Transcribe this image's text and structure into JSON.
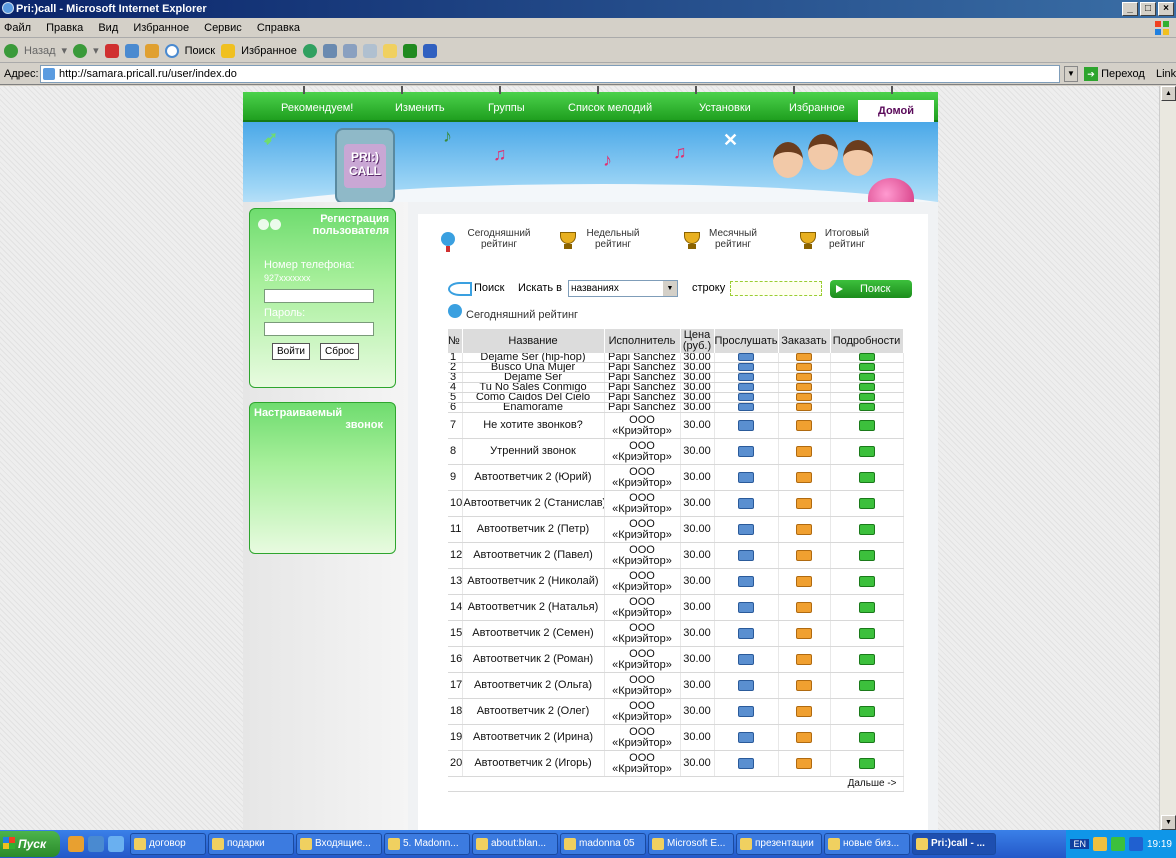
{
  "window": {
    "title": "Pri:)call - Microsoft Internet Explorer",
    "controls": [
      "_",
      "□",
      "×"
    ]
  },
  "menu": [
    "Файл",
    "Правка",
    "Вид",
    "Избранное",
    "Сервис",
    "Справка"
  ],
  "toolbar": {
    "back": "Назад",
    "search": "Поиск",
    "favorites": "Избранное"
  },
  "address": {
    "label": "Адрес:",
    "url": "http://samara.pricall.ru/user/index.do",
    "go": "Переход",
    "links": "Links"
  },
  "site": {
    "nav": [
      "Рекомендуем!",
      "Изменить",
      "Группы",
      "Список мелодий",
      "Установки",
      "Избранное"
    ],
    "nav_active": "Домой",
    "logo_line1": "PRI:)",
    "logo_line2": "CALL",
    "registration": {
      "title_line1": "Регистрация",
      "title_line2": "пользователя",
      "phone_label": "Номер телефона:",
      "phone_hint": "927xxxxxxx",
      "password_label": "Пароль:",
      "login_button": "Войти",
      "reset_button": "Сброс"
    },
    "custom_ring": {
      "title_line1": "Настраиваемый",
      "title_line2": "звонок"
    },
    "ratings": [
      {
        "line1": "Сегодняшний",
        "line2": "рейтинг",
        "icon": "pin-icon"
      },
      {
        "line1": "Недельный",
        "line2": "рейтинг",
        "icon": "trophy-icon"
      },
      {
        "line1": "Месячный",
        "line2": "рейтинг",
        "icon": "trophy-icon"
      },
      {
        "line1": "Итоговый",
        "line2": "рейтинг",
        "icon": "trophy-icon"
      }
    ],
    "search": {
      "label": "Поиск",
      "search_in": "Искать в",
      "select_value": "названиях",
      "string_label": "строку",
      "button": "Поиск"
    },
    "today_title": "Сегодняшний рейтинг",
    "table": {
      "headers": [
        "№",
        "Название",
        "Исполнитель",
        "Цена (руб.)",
        "Прослушать",
        "Заказать",
        "Подробности"
      ],
      "rows": [
        {
          "n": "1",
          "title": "Dejame Ser (hip-hop)",
          "artist": "Papi Sanchez",
          "artist2": "",
          "price": "30.00"
        },
        {
          "n": "2",
          "title": "Busco Una Mujer",
          "artist": "Papi Sanchez",
          "artist2": "",
          "price": "30.00"
        },
        {
          "n": "3",
          "title": "Dejame Ser",
          "artist": "Papi Sanchez",
          "artist2": "",
          "price": "30.00"
        },
        {
          "n": "4",
          "title": "Tu No Sales Conmigo",
          "artist": "Papi Sanchez",
          "artist2": "",
          "price": "30.00"
        },
        {
          "n": "5",
          "title": "Como Caidos Del Cielo",
          "artist": "Papi Sanchez",
          "artist2": "",
          "price": "30.00"
        },
        {
          "n": "6",
          "title": "Enamorame",
          "artist": "Papi Sanchez",
          "artist2": "",
          "price": "30.00"
        },
        {
          "n": "7",
          "title": "Не хотите звонков?",
          "artist": "ООО",
          "artist2": "«Криэйтор»",
          "price": "30.00"
        },
        {
          "n": "8",
          "title": "Утренний звонок",
          "artist": "ООО",
          "artist2": "«Криэйтор»",
          "price": "30.00"
        },
        {
          "n": "9",
          "title": "Автоответчик 2 (Юрий)",
          "artist": "ООО",
          "artist2": "«Криэйтор»",
          "price": "30.00"
        },
        {
          "n": "10",
          "title": "Автоответчик 2 (Станислав)",
          "artist": "ООО",
          "artist2": "«Криэйтор»",
          "price": "30.00"
        },
        {
          "n": "11",
          "title": "Автоответчик 2 (Петр)",
          "artist": "ООО",
          "artist2": "«Криэйтор»",
          "price": "30.00"
        },
        {
          "n": "12",
          "title": "Автоответчик 2 (Павел)",
          "artist": "ООО",
          "artist2": "«Криэйтор»",
          "price": "30.00"
        },
        {
          "n": "13",
          "title": "Автоответчик 2 (Николай)",
          "artist": "ООО",
          "artist2": "«Криэйтор»",
          "price": "30.00"
        },
        {
          "n": "14",
          "title": "Автоответчик 2 (Наталья)",
          "artist": "ООО",
          "artist2": "«Криэйтор»",
          "price": "30.00"
        },
        {
          "n": "15",
          "title": "Автоответчик 2 (Семен)",
          "artist": "ООО",
          "artist2": "«Криэйтор»",
          "price": "30.00"
        },
        {
          "n": "16",
          "title": "Автоответчик 2 (Роман)",
          "artist": "ООО",
          "artist2": "«Криэйтор»",
          "price": "30.00"
        },
        {
          "n": "17",
          "title": "Автоответчик 2 (Ольга)",
          "artist": "ООО",
          "artist2": "«Криэйтор»",
          "price": "30.00"
        },
        {
          "n": "18",
          "title": "Автоответчик 2 (Олег)",
          "artist": "ООО",
          "artist2": "«Криэйтор»",
          "price": "30.00"
        },
        {
          "n": "19",
          "title": "Автоответчик 2 (Ирина)",
          "artist": "ООО",
          "artist2": "«Криэйтор»",
          "price": "30.00"
        },
        {
          "n": "20",
          "title": "Автоответчик 2 (Игорь)",
          "artist": "ООО",
          "artist2": "«Криэйтор»",
          "price": "30.00"
        }
      ],
      "more": "Дальше ->"
    }
  },
  "taskbar": {
    "start": "Пуск",
    "tasks": [
      "договор",
      "подарки",
      "Входящие...",
      "5. Madonn...",
      "about:blan...",
      "madonna 05",
      "Microsoft E...",
      "презентации",
      "новые биз...",
      "Pri:)call - ..."
    ],
    "active_task": "Pri:)call - ...",
    "lang": "EN",
    "clock": "19:19"
  },
  "colors": {
    "nav_green": "#1f9f1f",
    "title_blue": "#0a246a",
    "active_tab_text": "#5a0a5a",
    "listen_icon": "#5a8fd0",
    "order_icon": "#f0a030",
    "details_icon": "#3cc03c"
  }
}
